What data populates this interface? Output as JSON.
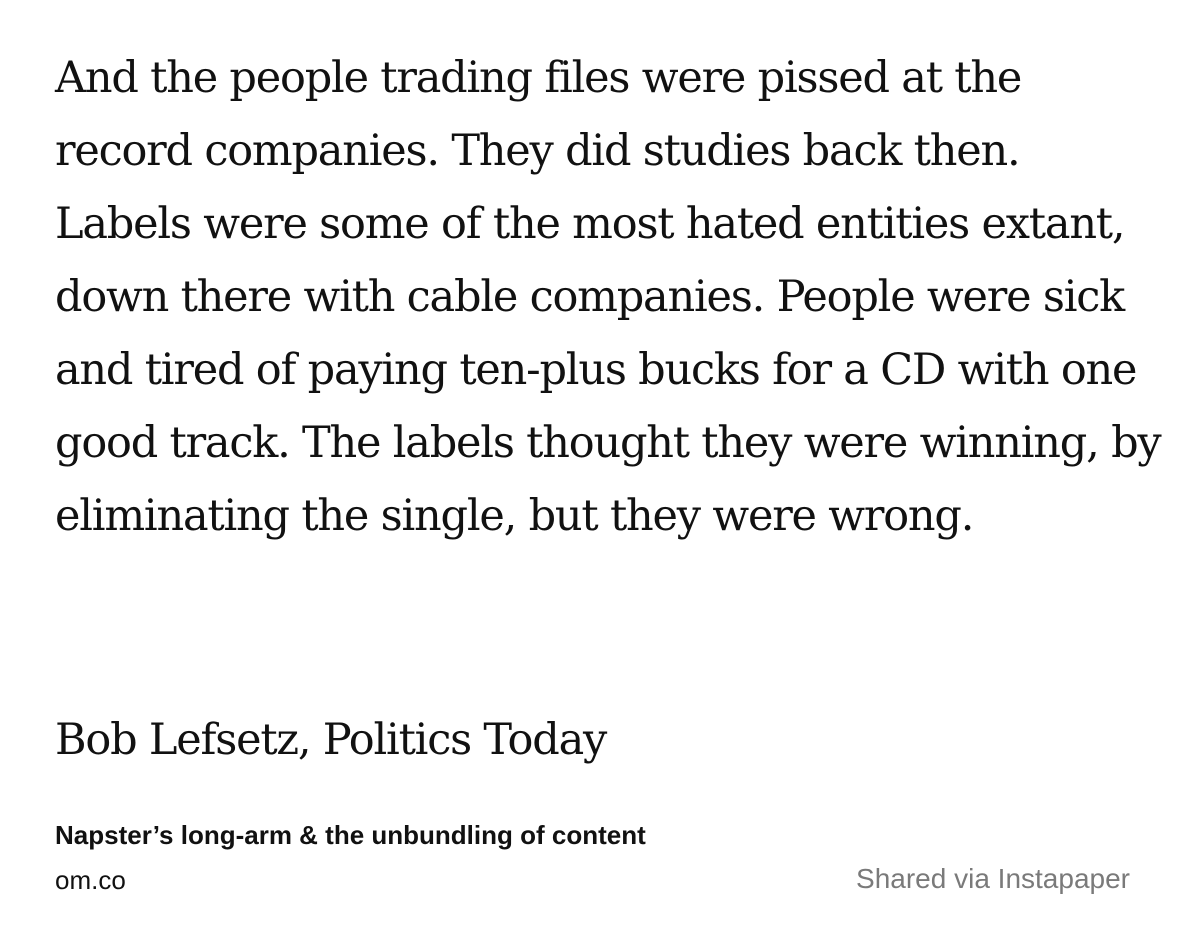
{
  "quote": {
    "text": "And the people trading files were pissed at the record companies. They did studies back then. Labels were some of the most hated entities extant, down there with cable companies. People were sick and tired of paying ten-plus bucks for a CD with one good track. The labels thought they were winning, by eliminating the single, but they were wrong."
  },
  "attribution": "Bob Lefsetz, Politics Today",
  "article": {
    "title": "Napster’s long-arm & the unbundling of content",
    "domain": "om.co"
  },
  "footer": {
    "shared_via": "Shared via Instapaper"
  }
}
